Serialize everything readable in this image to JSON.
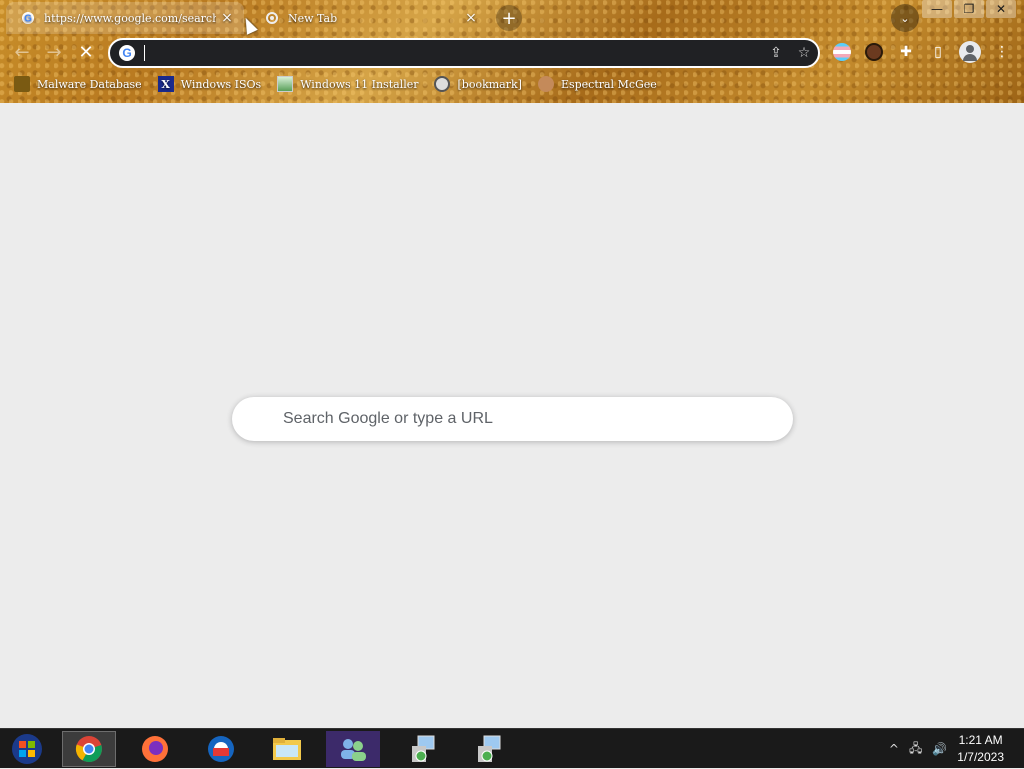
{
  "tabs": [
    {
      "title": "https://www.google.com/search?q",
      "icon": "google-icon",
      "active": true,
      "close": "×"
    },
    {
      "title": "New Tab",
      "icon": "loading-icon",
      "active": false,
      "close": "×"
    }
  ],
  "tab_strip": {
    "new_tab": "+",
    "tab_search": "⌄"
  },
  "window_controls": {
    "minimize": "—",
    "restore": "❐",
    "close": "✕"
  },
  "toolbar": {
    "back": "←",
    "forward": "→",
    "stop": "✕",
    "share": "⇪",
    "bookmark_star": "☆",
    "omnibox_value": ""
  },
  "extensions": {
    "puzzle": "✚",
    "side_panel": "▯",
    "menu": "⋮"
  },
  "bookmarks": [
    {
      "label": "Malware Database",
      "icon": "malware-icon"
    },
    {
      "label": "Windows ISOs",
      "icon": "x-icon",
      "glyph": "X"
    },
    {
      "label": "Windows 11 Installer",
      "icon": "windows-installer-icon"
    },
    {
      "label": "[bookmark]",
      "icon": "disk-icon"
    },
    {
      "label": "Espectral McGee",
      "icon": "face-icon"
    }
  ],
  "ntp": {
    "search_placeholder": "Search Google or type a URL"
  },
  "taskbar": {
    "items": [
      "start-orb",
      "chrome",
      "firefox",
      "outlook",
      "file-explorer",
      "people-app",
      "setup-1",
      "setup-2"
    ],
    "tray": {
      "chevron": "^",
      "network": "🖧",
      "volume": "🔊"
    },
    "clock": {
      "time": "1:21 AM",
      "date": "1/7/2023"
    }
  },
  "colors": {
    "accent": "#4285f4",
    "chrome_bg": "#b87920",
    "page_bg": "#ececec",
    "taskbar_bg": "#1a1a1a"
  }
}
